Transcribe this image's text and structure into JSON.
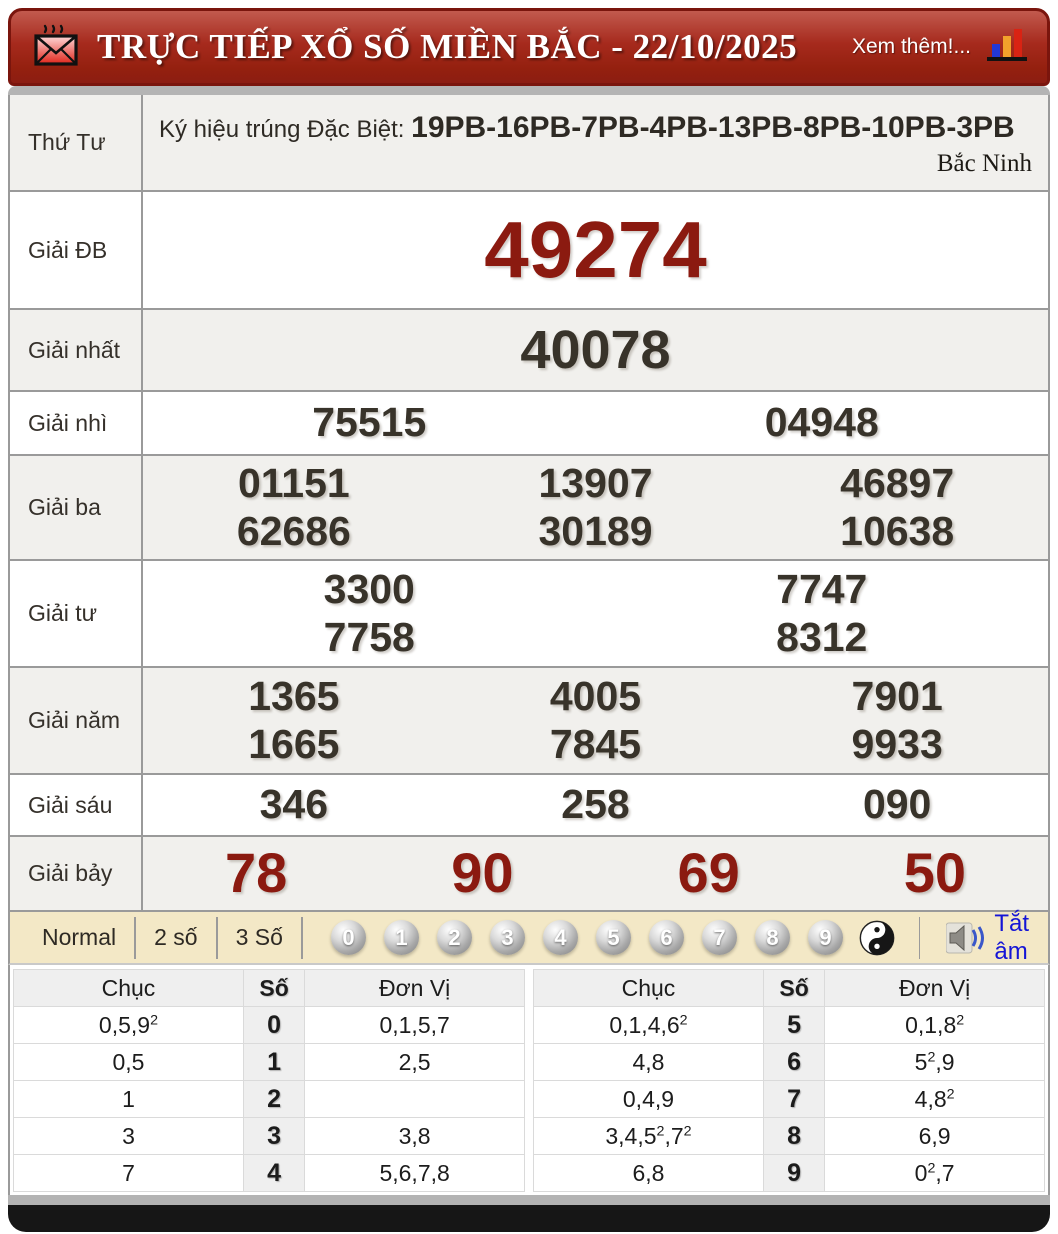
{
  "header": {
    "title": "TRỰC TIẾP XỔ SỐ MIỀN BẮC - 22/10/2025",
    "more_label": "Xem thêm!...",
    "envelope_icon": "hot-mail-envelope-icon",
    "chart_icon": "bar-chart-icon"
  },
  "info_row": {
    "day_label": "Thứ Tư",
    "sign_prefix": "Ký hiệu trúng Đặc Biệt: ",
    "sign_value": "19PB-16PB-7PB-4PB-13PB-8PB-10PB-3PB",
    "province": "Bắc Ninh"
  },
  "prizes": [
    {
      "label": "Giải ĐB",
      "cols": 1,
      "style": "xl-red",
      "values": [
        "49274"
      ]
    },
    {
      "label": "Giải nhất",
      "cols": 1,
      "style": "lg-dark",
      "values": [
        "40078"
      ]
    },
    {
      "label": "Giải nhì",
      "cols": 2,
      "style": "md-dark",
      "values": [
        "75515",
        "04948"
      ]
    },
    {
      "label": "Giải ba",
      "cols": 3,
      "style": "md-dark",
      "values": [
        "01151",
        "13907",
        "46897",
        "62686",
        "30189",
        "10638"
      ]
    },
    {
      "label": "Giải tư",
      "cols": 2,
      "style": "md-dark",
      "values": [
        "3300",
        "7747",
        "7758",
        "8312"
      ]
    },
    {
      "label": "Giải năm",
      "cols": 3,
      "style": "md-dark",
      "values": [
        "1365",
        "4005",
        "7901",
        "1665",
        "7845",
        "9933"
      ]
    },
    {
      "label": "Giải sáu",
      "cols": 3,
      "style": "md-dark",
      "values": [
        "346",
        "258",
        "090"
      ]
    },
    {
      "label": "Giải bảy",
      "cols": 4,
      "style": "lg-red",
      "values": [
        "78",
        "90",
        "69",
        "50"
      ]
    }
  ],
  "controls": {
    "tabs": [
      "Normal",
      "2 số",
      "3 Số"
    ],
    "balls": [
      "0",
      "1",
      "2",
      "3",
      "4",
      "5",
      "6",
      "7",
      "8",
      "9"
    ],
    "yinyang_icon": "yin-yang-icon",
    "mute_icon": "speaker-icon",
    "mute_label": "Tắt âm"
  },
  "stats": {
    "headers": [
      "Chục",
      "Số",
      "Đơn Vị"
    ],
    "left_rows": [
      [
        "0,5,9^2",
        "0",
        "0,1,5,7"
      ],
      [
        "0,5",
        "1",
        "2,5"
      ],
      [
        "1",
        "2",
        ""
      ],
      [
        "3",
        "3",
        "3,8"
      ],
      [
        "7",
        "4",
        "5,6,7,8"
      ]
    ],
    "right_rows": [
      [
        "0,1,4,6^2",
        "5",
        "0,1,8^2"
      ],
      [
        "4,8",
        "6",
        "5^2,9"
      ],
      [
        "0,4,9",
        "7",
        "4,8^2"
      ],
      [
        "3,4,5^2,7^2",
        "8",
        "6,9"
      ],
      [
        "6,8",
        "9",
        "0^2,7"
      ]
    ]
  },
  "colors": {
    "accent_red": "#8b1a10",
    "header_red": "#9b2016",
    "number_dark": "#38332a",
    "control_bg": "#f3e8c6",
    "mute_link_blue": "#1515d6"
  }
}
